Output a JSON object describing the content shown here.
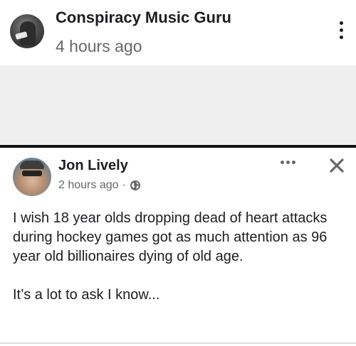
{
  "post": {
    "author": "Conspiracy Music Guru",
    "time": "4 hours ago",
    "avatar_icon": "profile-avatar",
    "menu_icon": "more-vertical-icon"
  },
  "embedded_post": {
    "author": "Jon Lively",
    "time": "2 hours ago",
    "separator": "·",
    "privacy_icon": "globe-icon",
    "more_icon": "more-horizontal-icon",
    "close_icon": "close-icon",
    "text_lines": [
      "I wish 18 year olds dropping dead of heart attacks during hockey games got as much attention as 96 year old billionaires dying of old age.",
      "It’s a lot to ask I know..."
    ]
  },
  "colors": {
    "text": "#1c1e21",
    "secondary_text": "#65676b",
    "gap_background": "#efefef"
  }
}
